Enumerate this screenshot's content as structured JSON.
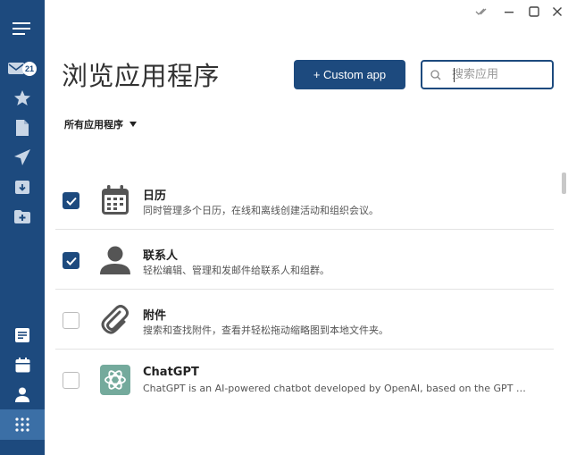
{
  "window": {
    "controls": [
      "checkmark-icon",
      "minimize-icon",
      "maximize-icon",
      "close-icon"
    ]
  },
  "sidebar": {
    "mail_badge": "21",
    "items": [
      {
        "icon": "menu-icon"
      },
      {
        "icon": "mail-icon"
      },
      {
        "icon": "star-icon"
      },
      {
        "icon": "document-icon"
      },
      {
        "icon": "send-icon"
      },
      {
        "icon": "archive-icon"
      },
      {
        "icon": "folder-add-icon"
      },
      {
        "icon": "notes-icon"
      },
      {
        "icon": "calendar-icon"
      },
      {
        "icon": "contacts-icon"
      },
      {
        "icon": "apps-grid-icon"
      }
    ],
    "colors": {
      "background": "#1d4a7e",
      "active": "#3b6fa6"
    }
  },
  "header": {
    "title": "浏览应用程序",
    "custom_button_label": "+ Custom app",
    "search_placeholder": "搜索应用"
  },
  "filter": {
    "label": "所有应用程序"
  },
  "apps": [
    {
      "name": "日历",
      "description": "同时管理多个日历，在线和离线创建活动和组织会议。",
      "checked": true,
      "icon": "calendar-icon"
    },
    {
      "name": "联系人",
      "description": "轻松编辑、管理和发邮件给联系人和组群。",
      "checked": true,
      "icon": "person-icon"
    },
    {
      "name": "附件",
      "description": "搜索和查找附件，查看并轻松拖动缩略图到本地文件夹。",
      "checked": false,
      "icon": "paperclip-icon"
    },
    {
      "name": "ChatGPT",
      "description": "ChatGPT is an AI-powered chatbot developed by OpenAI, based on the GPT language model.",
      "checked": false,
      "icon": "openai-icon"
    }
  ],
  "colors": {
    "accent": "#1d4a7e",
    "chatgpt": "#74aa9c"
  }
}
